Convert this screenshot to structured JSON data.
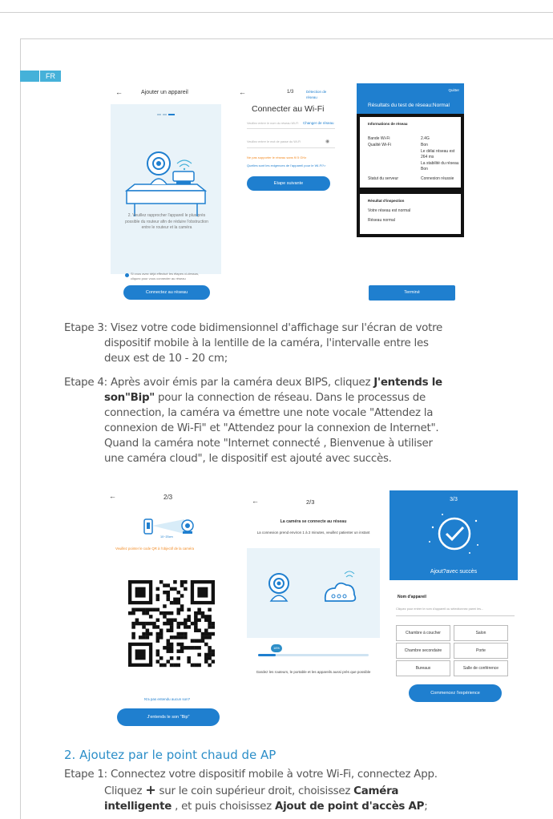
{
  "lang": "FR",
  "screen1": {
    "title": "Ajouter un appareil",
    "instruction": "2. Veuillez rapprocher l'appareil le plus près possible du routeur afin de réduire l'obstruction entre le routeur et la caméra",
    "check_text": "Si vous avez déjà effectué les étapes ci-dessus, cliquez pour vous connecter au réseau",
    "button": "Connectez au réseau"
  },
  "screen2": {
    "step": "1/3",
    "link": "Détection de réseau",
    "title": "Connecter au Wi-Fi",
    "ssid_placeholder": "Veuillez entrer le nom du réseau Wi-Fi",
    "change": "Changer de réseau",
    "pwd_placeholder": "Veuillez entrer le mot de passe du Wi-Fi",
    "warning": "Ne pas supporter le réseau sans fil 5 GHz",
    "help": "Quelles sont les exigences de l'appareil pour le Wi-Fi?>",
    "button": "Etape suivante"
  },
  "screen3": {
    "quit": "Quitter",
    "result_title": "Résultats du test de réseau:Normal",
    "info_title": "Informations de réseau",
    "rows": [
      {
        "k": "Bande Wi-Fi",
        "v": "2.4G"
      },
      {
        "k": "Qualité Wi-Fi",
        "v": "Bon\nLe délai réseau est 264 ms\nLa stabilité du réseau Bon"
      },
      {
        "k": "Statut du serveur",
        "v": "Connexion réussie"
      }
    ],
    "inspect_title": "Résultat d'inspection",
    "inspect_1": "Votre réseau est normal",
    "inspect_2": "Réseau normal",
    "done": "Terminé"
  },
  "step3": {
    "label": "Etape 3:",
    "line1": "Visez votre code bidimensionnel d'affichage sur l'écran de votre",
    "line2": "dispositif mobile à la lentille de la caméra,  l'intervalle entre les",
    "line3": "deux est de 10 - 20 cm;"
  },
  "step4": {
    "label": "Etape 4:",
    "pre1": "Après avoir émis par la caméra deux BIPS, cliquez ",
    "bold1": "J'entends le",
    "bold2": "son\"Bip\"",
    "post2": " pour la connection de réseau. Dans le processus de",
    "line3": "connection, la caméra va émettre une note vocale \"Attendez la",
    "line4": "connexion de Wi-Fi\" et \"Attendez pour la connexion de Internet\".",
    "line5": "Quand la caméra note \"Internet connecté ,   Bienvenue à utiliser",
    "line6": "une caméra cloud\", le dispositif est ajouté avec succès."
  },
  "screen4": {
    "step": "2/3",
    "distance": "10~20cm",
    "hint": "Veuillez pointer le code QR à l'objectif de la caméra",
    "no_sound": "N'a pas entendu aucun son?",
    "button": "J'entends le son \"Bip\""
  },
  "screen5": {
    "step": "2/3",
    "title": "La caméra se connecte au réseau",
    "subtitle": "La connexion prend environ 1 à 2 minutes, veuillez patienter un instant",
    "progress_label": "16%",
    "progress": 0.16,
    "footer": "Gardez les routeurs, le portable et les appareils aussi près que possible"
  },
  "screen6": {
    "step": "3/3",
    "success": "Ajout?avec succès",
    "name_label": "Nom d'appareil",
    "name_placeholder": "Cliquez pour entrer le nom d'appareil ou sélectionnez parmi les...",
    "rooms": [
      "Chambre à coucher",
      "Salon",
      "Chambre secondaire",
      "Porte",
      "Bureaux",
      "Salle de conférence"
    ],
    "button": "Commencez l'expérience"
  },
  "section2": {
    "title": "2. Ajoutez par le point chaud de AP"
  },
  "step1b": {
    "label": "Etape 1:",
    "line1": "Connectez votre dispositif mobile à votre Wi-Fi, connectez App.",
    "pre2": "Cliquez ",
    "plus": "+",
    "mid2": " sur le coin supérieur droit, choisissez ",
    "bold2": "Caméra",
    "bold3": "intelligente",
    "mid3": " , et puis choisissez ",
    "bold3b": "Ajout de point d'accès AP",
    "end3": ";"
  },
  "colors": {
    "accent": "#1f7fcf",
    "section": "#2c8ec8",
    "tag": "#45b1d9"
  }
}
